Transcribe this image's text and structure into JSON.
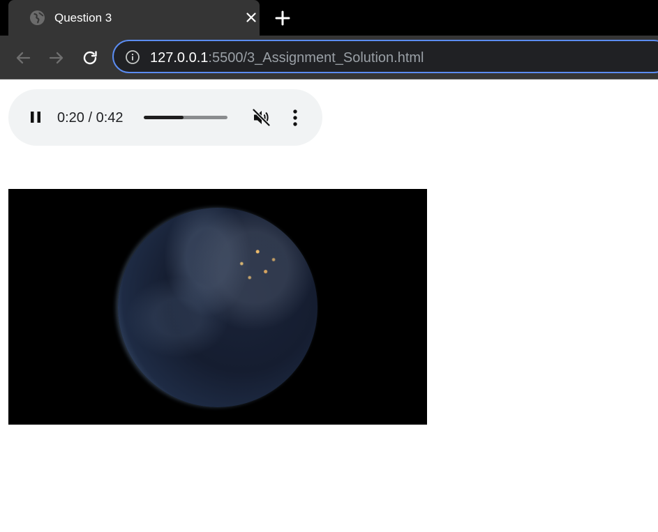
{
  "browser": {
    "tab_title": "Question 3",
    "url_host": "127.0.0.1",
    "url_rest": ":5500/3_Assignment_Solution.html",
    "accent_color": "#5b8cf1",
    "icons": [
      "globe-icon",
      "close-icon",
      "plus-icon",
      "back-arrow-icon",
      "forward-arrow-icon",
      "reload-icon",
      "info-icon"
    ]
  },
  "audio": {
    "time_display": "0:20 / 0:42",
    "progress_fraction": 0.476,
    "muted": true,
    "playing": true,
    "icons": [
      "pause-icon",
      "muted-speaker-icon",
      "more-vert-icon"
    ]
  },
  "video": {
    "content": "earth-at-night"
  }
}
